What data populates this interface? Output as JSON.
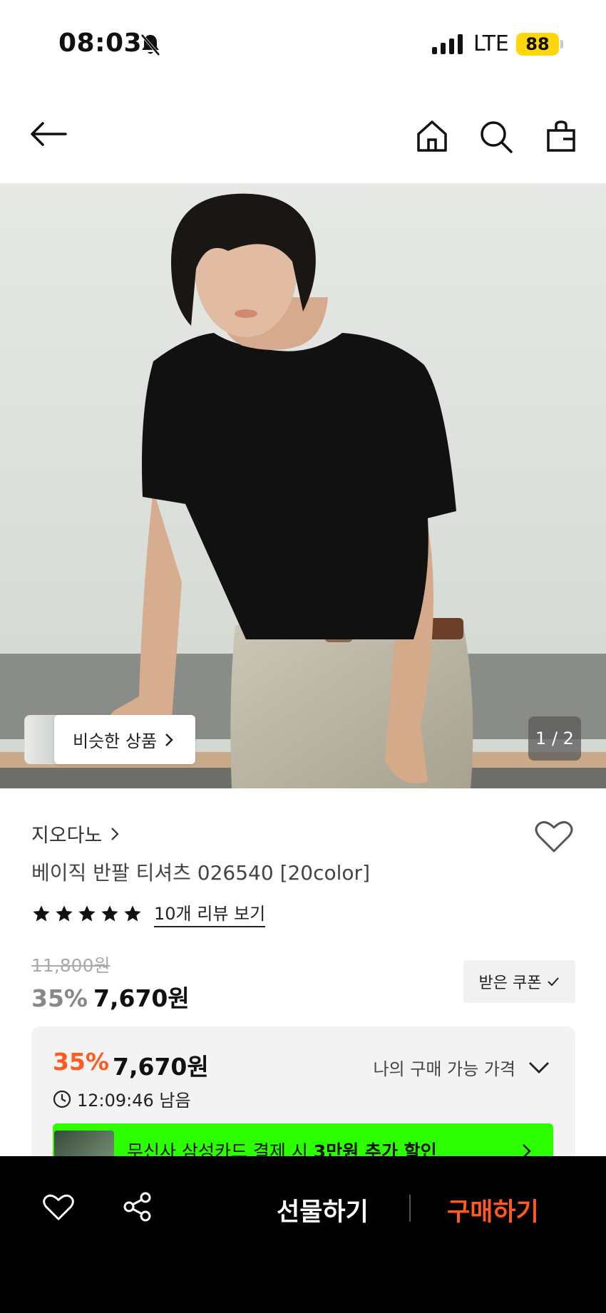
{
  "status_bar": {
    "time": "08:03",
    "network": "LTE",
    "battery": "88"
  },
  "gallery": {
    "similar_label": "비슷한 상품",
    "pager": "1 / 2"
  },
  "product": {
    "brand": "지오다노",
    "title": "베이직 반팔 티셔츠 026540 [20color]",
    "rating": 5,
    "reviews_label": "10개 리뷰 보기",
    "original_price": "11,800원",
    "discount": "35%",
    "price": "7,670원",
    "coupon_label": "받은 쿠폰"
  },
  "price_box": {
    "discount": "35%",
    "price": "7,670원",
    "timer": "12:09:46 남음",
    "toggle_label": "나의 구매 가능 가격",
    "banner_text_pre": "무신사 삼성카드 결제 시 ",
    "banner_text_bold": "3만원 추가 할인"
  },
  "bottom_bar": {
    "gift_label": "선물하기",
    "buy_label": "구매하기"
  },
  "colors": {
    "accent": "#ff5a1f",
    "banner": "#2bff00",
    "battery": "#ffd60a"
  }
}
